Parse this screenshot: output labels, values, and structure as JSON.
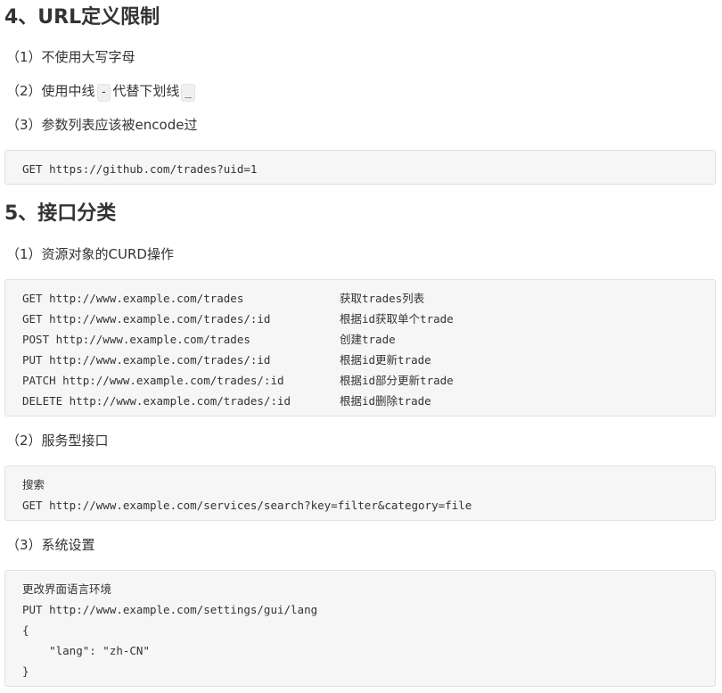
{
  "section4": {
    "heading": "4、URL定义限制",
    "items": [
      {
        "text": "（1）不使用大写字母"
      },
      {
        "prefix": "（2）使用中线",
        "code1": "-",
        "middle": "代替下划线",
        "code2": "_"
      },
      {
        "text": "（3）参数列表应该被encode过"
      }
    ],
    "code": "GET https://github.com/trades?uid=1"
  },
  "section5": {
    "heading": "5、接口分类",
    "sub1": {
      "title": "（1）资源对象的CURD操作",
      "rows": [
        {
          "request": "GET http://www.example.com/trades",
          "desc": "获取trades列表"
        },
        {
          "request": "GET http://www.example.com/trades/:id",
          "desc": "根据id获取单个trade"
        },
        {
          "request": "POST http://www.example.com/trades",
          "desc": "创建trade"
        },
        {
          "request": "PUT http://www.example.com/trades/:id",
          "desc": "根据id更新trade"
        },
        {
          "request": "PATCH http://www.example.com/trades/:id",
          "desc": "根据id部分更新trade"
        },
        {
          "request": "DELETE http://www.example.com/trades/:id",
          "desc": "根据id删除trade"
        }
      ]
    },
    "sub2": {
      "title": "（2）服务型接口",
      "lines": [
        "搜索",
        "GET http://www.example.com/services/search?key=filter&category=file"
      ]
    },
    "sub3": {
      "title": "（3）系统设置",
      "lines": [
        "更改界面语言环境",
        "PUT http://www.example.com/settings/gui/lang",
        "{",
        "    \"lang\": \"zh-CN\"",
        "}"
      ]
    }
  }
}
